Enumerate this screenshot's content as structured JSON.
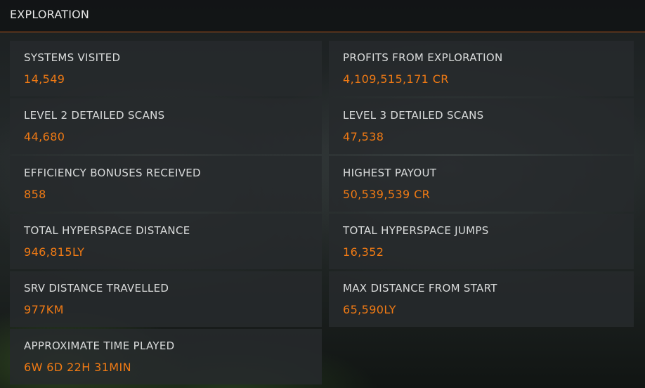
{
  "panel": {
    "title": "EXPLORATION"
  },
  "colors": {
    "accent": "#f07a14",
    "divider": "#b8561a",
    "label": "#dadcdc"
  },
  "stats": [
    {
      "label": "SYSTEMS VISITED",
      "value": "14,549"
    },
    {
      "label": "PROFITS FROM EXPLORATION",
      "value": "4,109,515,171 CR"
    },
    {
      "label": "LEVEL 2 DETAILED SCANS",
      "value": "44,680"
    },
    {
      "label": "LEVEL 3 DETAILED SCANS",
      "value": "47,538"
    },
    {
      "label": "EFFICIENCY BONUSES RECEIVED",
      "value": "858"
    },
    {
      "label": "HIGHEST PAYOUT",
      "value": "50,539,539 CR"
    },
    {
      "label": "TOTAL HYPERSPACE DISTANCE",
      "value": "946,815LY"
    },
    {
      "label": "TOTAL HYPERSPACE JUMPS",
      "value": "16,352"
    },
    {
      "label": "SRV DISTANCE TRAVELLED",
      "value": "977KM"
    },
    {
      "label": "MAX DISTANCE FROM START",
      "value": "65,590LY"
    },
    {
      "label": "APPROXIMATE TIME PLAYED",
      "value": "6W 6D 22H 31MIN"
    }
  ]
}
